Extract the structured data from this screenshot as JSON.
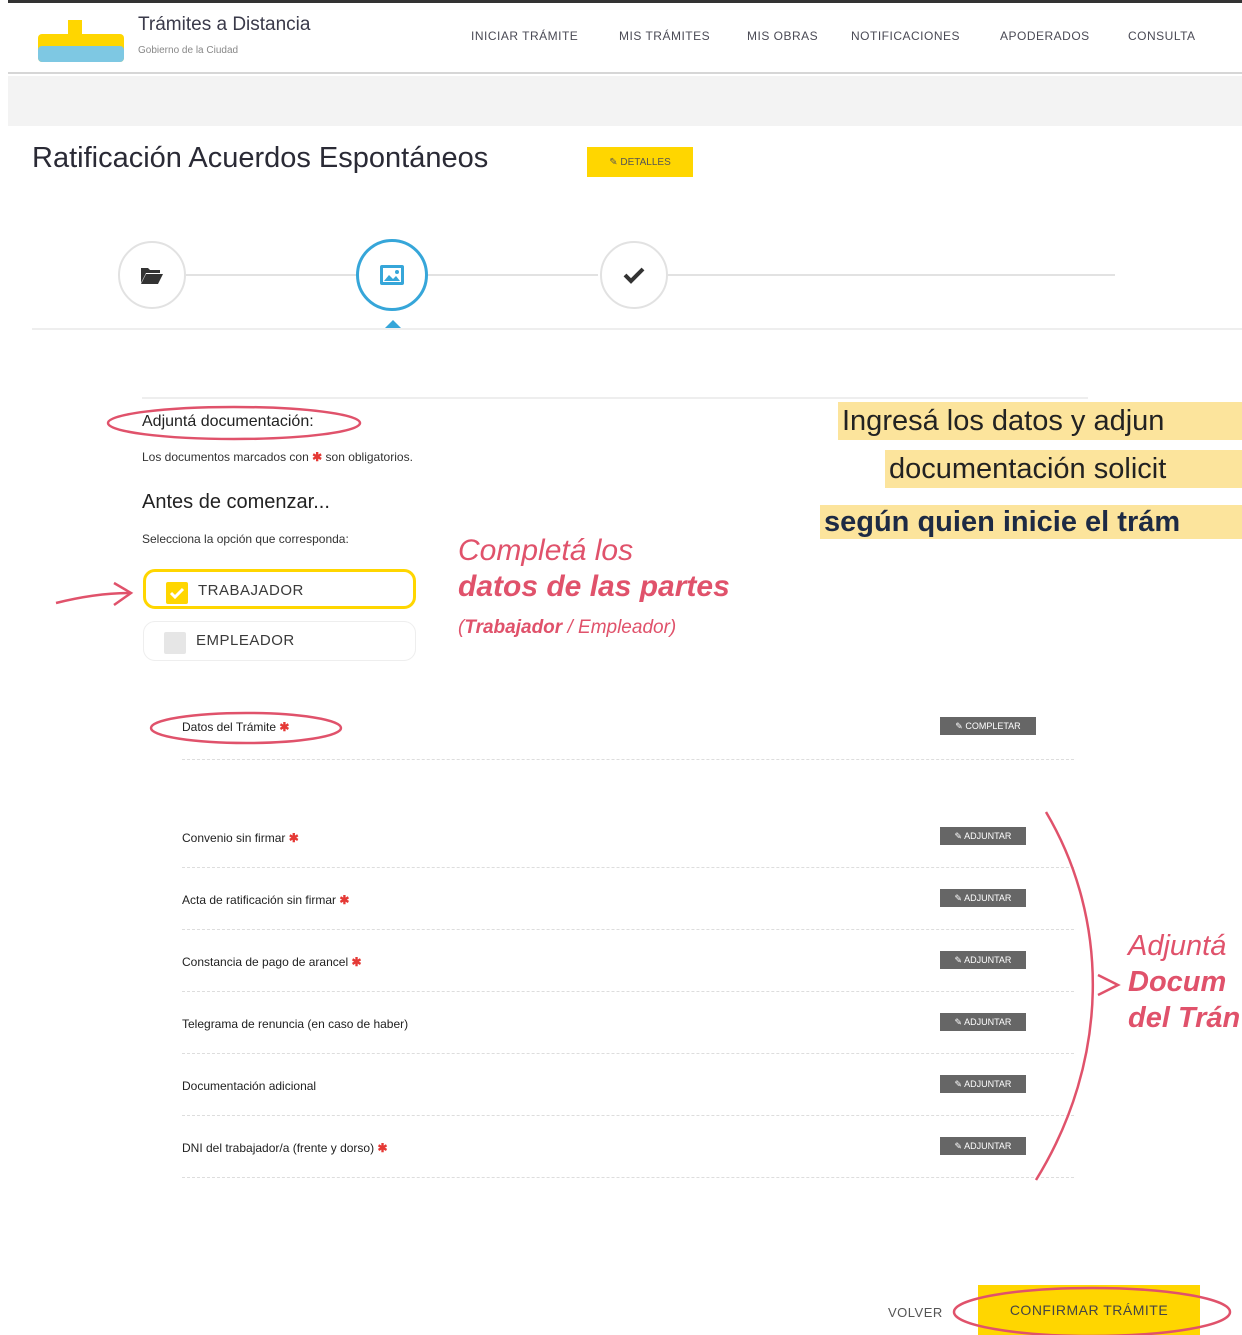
{
  "header": {
    "title": "Trámites a Distancia",
    "subtitle": "Gobierno de la Ciudad",
    "nav": [
      "INICIAR TRÁMITE",
      "MIS TRÁMITES",
      "MIS OBRAS",
      "NOTIFICACIONES",
      "APODERADOS",
      "CONSULTA"
    ]
  },
  "page": {
    "title": "Ratificación Acuerdos Espontáneos",
    "details_label": "✎ DETALLES"
  },
  "steps": [
    {
      "icon": "folder-open-icon",
      "state": "done"
    },
    {
      "icon": "image-icon",
      "state": "active"
    },
    {
      "icon": "check-icon",
      "state": "pending"
    }
  ],
  "form": {
    "attach_title": "Adjuntá documentación:",
    "attach_note_prefix": "Los documentos marcados con",
    "attach_note_suffix": "son obligatorios.",
    "before_title": "Antes de comenzar...",
    "select_prompt": "Selecciona la opción que corresponda:",
    "options": [
      {
        "label": "TRABAJADOR",
        "selected": true
      },
      {
        "label": "EMPLEADOR",
        "selected": false
      }
    ],
    "tramite_label": "Datos del Trámite",
    "complete_label": "✎ COMPLETAR",
    "attach_button_label": "✎ ADJUNTAR",
    "documents": [
      {
        "label": "Convenio sin firmar",
        "required": true
      },
      {
        "label": "Acta de ratificación sin firmar",
        "required": true
      },
      {
        "label": "Constancia de pago de arancel",
        "required": true
      },
      {
        "label": "Telegrama de renuncia (en caso de haber)",
        "required": false
      },
      {
        "label": "Documentación adicional",
        "required": false
      },
      {
        "label": "DNI del trabajador/a (frente y dorso)",
        "required": true
      }
    ],
    "back_label": "VOLVER",
    "confirm_label": "CONFIRMAR TRÁMITE"
  },
  "annotations": {
    "intro": [
      "Ingresá los datos y adjun",
      "documentación solicit",
      "según quien inicie el trám"
    ],
    "parties_line1": "Completá los",
    "parties_line2": "datos de las partes",
    "parties_open": "(",
    "parties_bold": "Trabajador",
    "parties_rest": " / Empleador)",
    "docs_line1": "Adjuntá",
    "docs_line2": "Docum",
    "docs_line3": "del Trán"
  },
  "colors": {
    "accent_yellow": "#ffd600",
    "active_step": "#36a6d9",
    "annotation_pink": "#e0526b",
    "highlight": "#fce49c",
    "required_red": "#e53935"
  }
}
